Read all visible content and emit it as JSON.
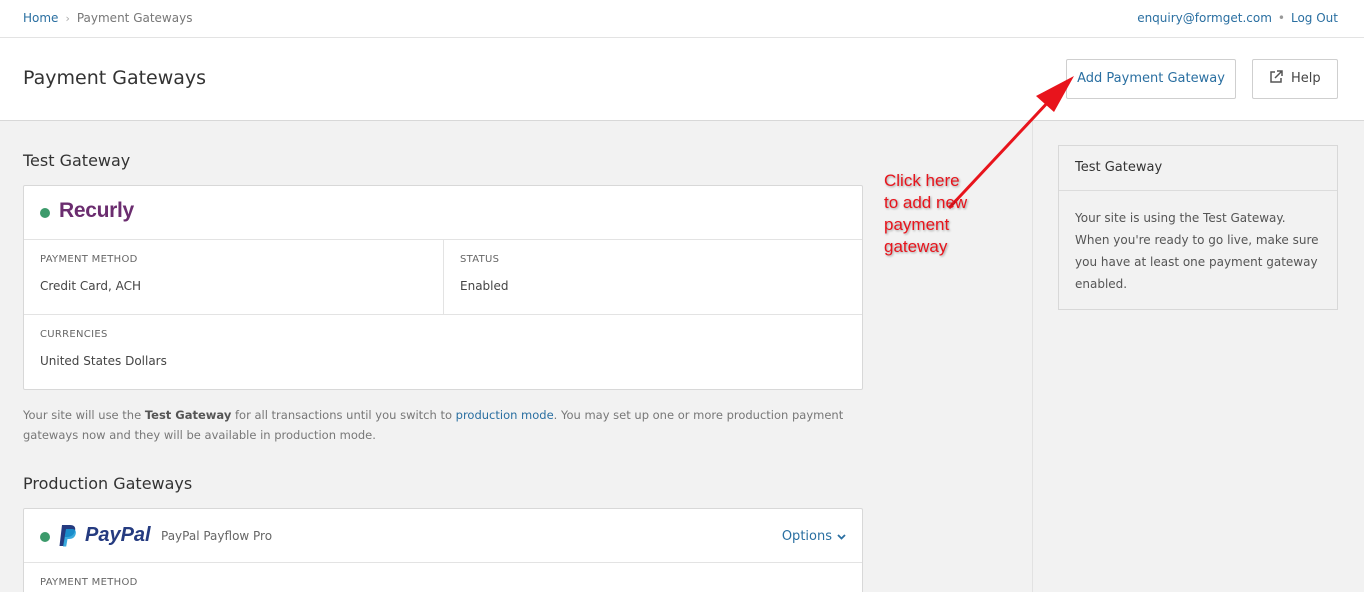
{
  "breadcrumb": {
    "home": "Home",
    "separator": "›",
    "current": "Payment Gateways"
  },
  "user": {
    "email": "enquiry@formget.com",
    "separator": "•",
    "logout": "Log Out"
  },
  "header": {
    "title": "Payment Gateways",
    "add_button": "Add Payment Gateway",
    "help_button": "Help"
  },
  "test_section": {
    "title": "Test Gateway",
    "gateway_logo": "Recurly",
    "payment_method_label": "PAYMENT METHOD",
    "payment_method_value": "Credit Card, ACH",
    "status_label": "STATUS",
    "status_value": "Enabled",
    "currencies_label": "CURRENCIES",
    "currencies_value": "United States Dollars"
  },
  "note": {
    "part1": "Your site will use the ",
    "bold": "Test Gateway",
    "part2": " for all transactions until you switch to ",
    "link": "production mode",
    "part3": ". You may set up one or more production payment gateways now and they will be available in production mode."
  },
  "production_section": {
    "title": "Production Gateways",
    "gateway_logo": "PayPal",
    "gateway_name": "PayPal Payflow Pro",
    "options": "Options",
    "payment_method_label": "PAYMENT METHOD"
  },
  "sidebar": {
    "title": "Test Gateway",
    "body": "Your site is using the Test Gateway. When you're ready to go live, make sure you have at least one payment gateway enabled."
  },
  "annotation": {
    "text": "Click here to add new payment gateway"
  },
  "colors": {
    "link": "#2a6fa1",
    "status_dot": "#3c9a6b",
    "recurly": "#6b2d6f",
    "paypal_dark": "#253b80",
    "paypal_light": "#179bd7",
    "annotation": "#e8141c"
  },
  "icons": {
    "help": "external-link-icon",
    "options": "chevron-down-icon"
  }
}
